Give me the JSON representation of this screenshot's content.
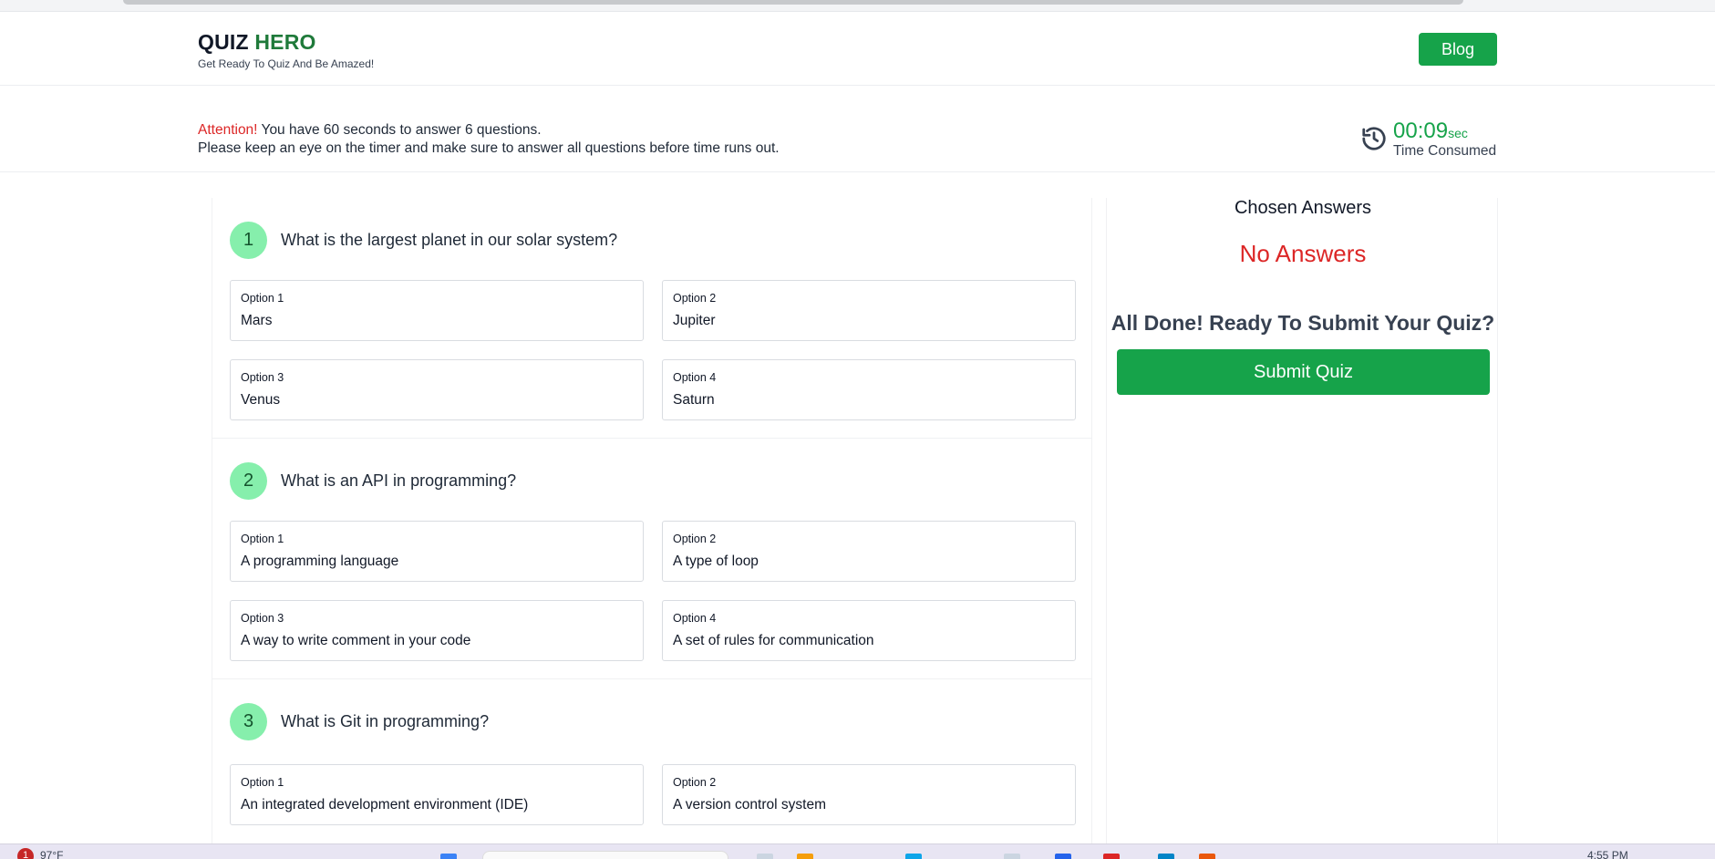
{
  "brand": {
    "quiz": "QUIZ",
    "hero": "HERO",
    "tagline": "Get Ready To Quiz And Be Amazed!"
  },
  "nav": {
    "blog_label": "Blog"
  },
  "notice": {
    "attention": "Attention!",
    "line1": " You have 60 seconds to answer 6 questions.",
    "line2": "Please keep an eye on the timer and make sure to answer all questions before time runs out."
  },
  "timer": {
    "value": "00:09",
    "unit": "sec",
    "label": "Time Consumed",
    "icon": "history-icon"
  },
  "questions": [
    {
      "number": "1",
      "text": "What is the largest planet in our solar system?",
      "options": [
        {
          "label": "Option 1",
          "value": "Mars"
        },
        {
          "label": "Option 2",
          "value": "Jupiter"
        },
        {
          "label": "Option 3",
          "value": "Venus"
        },
        {
          "label": "Option 4",
          "value": "Saturn"
        }
      ]
    },
    {
      "number": "2",
      "text": "What is an API in programming?",
      "options": [
        {
          "label": "Option 1",
          "value": "A programming language"
        },
        {
          "label": "Option 2",
          "value": "A type of loop"
        },
        {
          "label": "Option 3",
          "value": "A way to write comment in your code"
        },
        {
          "label": "Option 4",
          "value": "A set of rules for communication"
        }
      ]
    },
    {
      "number": "3",
      "text": "What is Git in programming?",
      "options": [
        {
          "label": "Option 1",
          "value": "An integrated development environment (IDE)"
        },
        {
          "label": "Option 2",
          "value": "A version control system"
        }
      ]
    }
  ],
  "side": {
    "chosen_title": "Chosen Answers",
    "empty_state": "No Answers",
    "done_text": "All Done! Ready To Submit Your Quiz?",
    "submit_label": "Submit Quiz"
  },
  "taskbar": {
    "notification_count": "1",
    "temperature": "97°F",
    "clock": "4:55 PM"
  },
  "colors": {
    "accent": "#16a34a",
    "brand_green": "#1f7a3a",
    "alert_red": "#dc2626",
    "badge_bg": "#86efac"
  }
}
